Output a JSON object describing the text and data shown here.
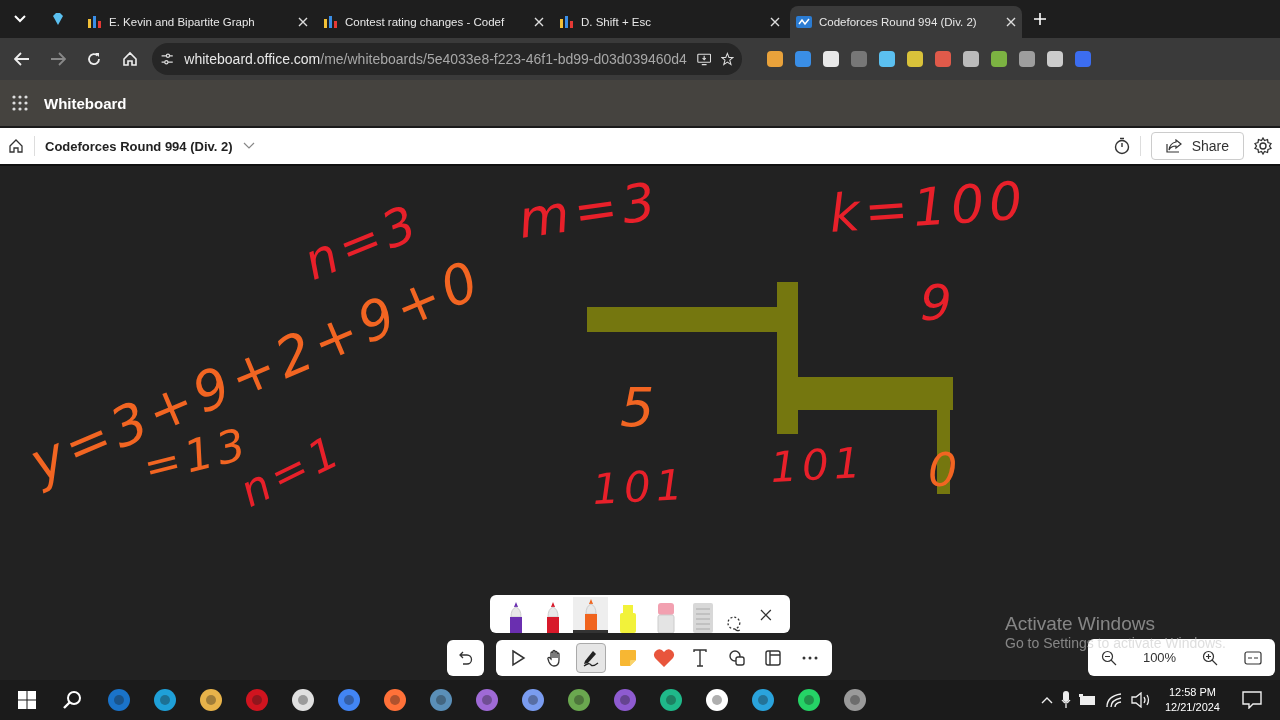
{
  "browser": {
    "tabs": [
      {
        "label": "E. Kevin and Bipartite Graph",
        "selected": false
      },
      {
        "label": "Contest rating changes - Codef",
        "selected": false
      },
      {
        "label": "D. Shift + Esc",
        "selected": false
      },
      {
        "label": "Codeforces Round 994 (Div. 2)",
        "selected": true
      }
    ],
    "url": {
      "host": "whiteboard.office.com",
      "path": "/me/whiteboards/5e4033e8-f223-46f1-bd99-d03d039460d4"
    }
  },
  "app_bar": {
    "title": "Whiteboard"
  },
  "board": {
    "title": "Codeforces Round 994 (Div. 2)",
    "share": "Share"
  },
  "ink": [
    {
      "text": "n=3",
      "color": "#e8202a"
    },
    {
      "text": "m=3",
      "color": "#e8202a"
    },
    {
      "text": "k=100",
      "color": "#e8202a"
    },
    {
      "text": "y=3+9+2+9+0",
      "color": "#f26522"
    },
    {
      "text": "=13",
      "color": "#f26522"
    },
    {
      "text": "n=1",
      "color": "#e8202a"
    },
    {
      "text": "9",
      "color": "#e8202a"
    },
    {
      "text": "5",
      "color": "#f26522"
    },
    {
      "text": "101",
      "color": "#e8202a"
    },
    {
      "text": "101",
      "color": "#e8202a"
    },
    {
      "text": "0",
      "color": "#f26522"
    }
  ],
  "pens": [
    {
      "kind": "pen",
      "color": "#6a2fb0",
      "selected": false
    },
    {
      "kind": "pen",
      "color": "#d8192a",
      "selected": false
    },
    {
      "kind": "pen",
      "color": "#f0641e",
      "selected": true
    },
    {
      "kind": "highlighter",
      "color": "#f2f23a",
      "selected": false
    },
    {
      "kind": "eraser",
      "color": "#f2a0b0",
      "selected": false
    },
    {
      "kind": "ruler",
      "color": "#d8d8d8",
      "selected": false
    }
  ],
  "tools": [
    {
      "kind": "select",
      "selected": false
    },
    {
      "kind": "pan",
      "selected": false
    },
    {
      "kind": "ink",
      "selected": true
    },
    {
      "kind": "note",
      "selected": false
    },
    {
      "kind": "reaction",
      "selected": false
    },
    {
      "kind": "text",
      "selected": false
    },
    {
      "kind": "shapes",
      "selected": false
    },
    {
      "kind": "template",
      "selected": false
    },
    {
      "kind": "more",
      "selected": false
    }
  ],
  "zoom": {
    "value": "100%"
  },
  "os_notice": {
    "title": "Activate Windows",
    "subtitle": "Go to Settings to activate Windows."
  },
  "taskbar": {
    "time": "12:58 PM",
    "date": "12/21/2024"
  }
}
